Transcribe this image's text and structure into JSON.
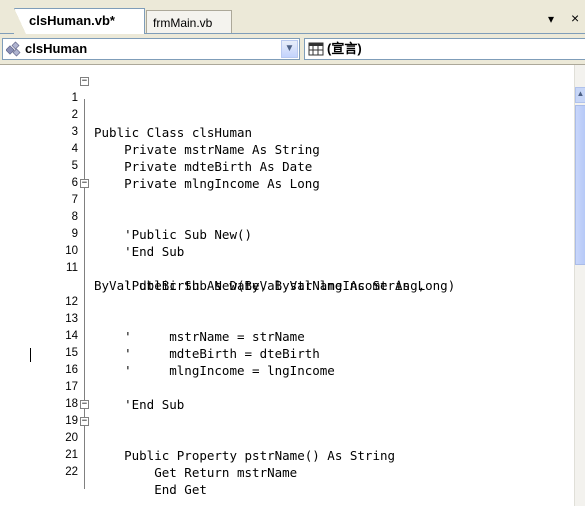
{
  "tabs": [
    {
      "label": "clsHuman.vb*",
      "active": true
    },
    {
      "label": "frmMain.vb",
      "active": false
    }
  ],
  "tab_controls": {
    "dropdown": "▾",
    "close": "×"
  },
  "nav": {
    "class_combo": "clsHuman",
    "member_combo": "(宣言)"
  },
  "code_lines": [
    {
      "num": "1",
      "text": "Public Class clsHuman"
    },
    {
      "num": "2",
      "text": ""
    },
    {
      "num": "3",
      "text": "    Private mstrName As String"
    },
    {
      "num": "4",
      "text": "    Private mdteBirth As Date"
    },
    {
      "num": "5",
      "text": "    Private mlngIncome As Long"
    },
    {
      "num": "6",
      "text": ""
    },
    {
      "num": "7",
      "text": "    'Public Sub New()"
    },
    {
      "num": "8",
      "text": ""
    },
    {
      "num": "9",
      "text": "    'End Sub"
    },
    {
      "num": "10",
      "text": ""
    },
    {
      "num": "11",
      "text": "    'Public Sub New(ByVal strName As String,"
    },
    {
      "num": "",
      "text": "ByVal dteBirth As Date, ByVal lngIncome As Long)"
    },
    {
      "num": "12",
      "text": ""
    },
    {
      "num": "13",
      "text": "    '     mstrName = strName"
    },
    {
      "num": "14",
      "text": "    '     mdteBirth = dteBirth"
    },
    {
      "num": "15",
      "text": "    '     mlngIncome = lngIncome"
    },
    {
      "num": "16",
      "text": ""
    },
    {
      "num": "17",
      "text": "    'End Sub"
    },
    {
      "num": "18",
      "text": ""
    },
    {
      "num": "19",
      "text": "    Public Property pstrName() As String"
    },
    {
      "num": "20",
      "text": "        Get"
    },
    {
      "num": "21",
      "text": "            Return mstrName"
    },
    {
      "num": "22",
      "text": "        End Get"
    }
  ],
  "colors": {
    "keyword": "#0000ff",
    "text": "#000000",
    "chrome": "#ece9d8"
  }
}
